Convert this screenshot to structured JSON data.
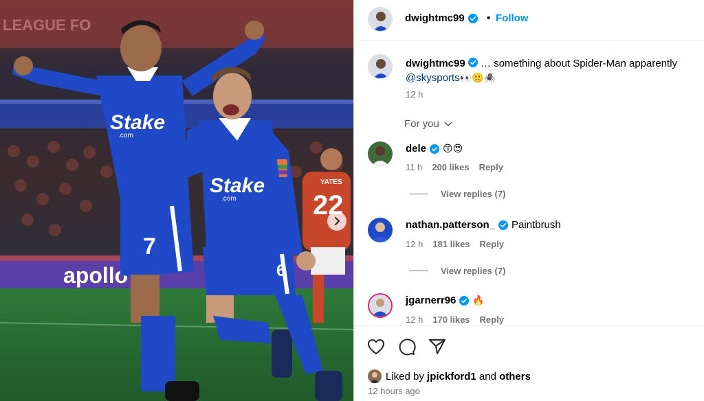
{
  "post": {
    "username": "dwightmc99",
    "follow_label": "Follow",
    "dot": "•"
  },
  "caption": {
    "username": "dwightmc99",
    "text": " … something about Spider-Man apparently ",
    "mention": "@skysports",
    "emojis": "👀🙂🕷️",
    "time": "12 h"
  },
  "sort": {
    "label": "For you"
  },
  "comments": [
    {
      "username": "dele",
      "text": "😙😍",
      "time": "11 h",
      "likes": "200 likes",
      "reply": "Reply",
      "view_replies": "View replies (7)"
    },
    {
      "username": "nathan.patterson_",
      "text": "Paintbrush",
      "time": "12 h",
      "likes": "181 likes",
      "reply": "Reply",
      "view_replies": "View replies (7)"
    },
    {
      "username": "jgarnerr96",
      "text": "🔥",
      "time": "12 h",
      "likes": "170 likes",
      "reply": "Reply"
    }
  ],
  "liked_by": {
    "prefix": "Liked by ",
    "user": "jpickford1",
    "middle": " and ",
    "others": "others"
  },
  "posted_ago": "12 hours ago",
  "photo_text": {
    "sponsor": "Stake",
    "sponsor_sub": ".com",
    "jersey_left": "7",
    "jersey_right": "6",
    "opponent_name": "YATES",
    "opponent_number": "22",
    "board": "apollo",
    "stadium_banner": "LEAGUE FO"
  },
  "icons": {
    "verified": "verified-badge-icon",
    "like": "heart-icon",
    "comment": "comment-icon",
    "share": "share-icon",
    "chevron": "chevron-down-icon",
    "next": "chevron-right-icon"
  },
  "colors": {
    "accent": "#0095f6",
    "kit_blue": "#1f49c7",
    "opponent_red": "#c8472b"
  }
}
